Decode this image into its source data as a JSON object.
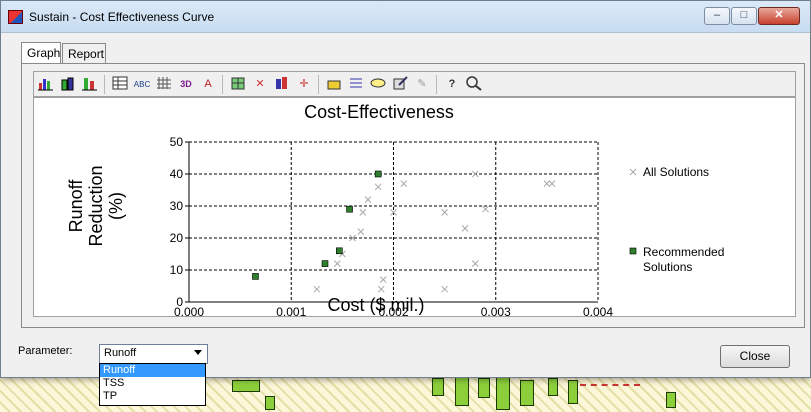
{
  "window": {
    "title": "Sustain - Cost Effectiveness Curve"
  },
  "title_buttons": {
    "minimize": "–",
    "maximize": "□",
    "close": "✕"
  },
  "tabs": [
    {
      "label": "Graph"
    },
    {
      "label": "Report"
    }
  ],
  "toolbar_icons": [
    "bar-chart-icon",
    "3d-bar-icon",
    "stacked-bar-icon",
    "table-icon",
    "abc-text-icon",
    "grid-lines-icon",
    "3d-view-icon",
    "font-style-icon",
    "pattern-icon",
    "scatter-icon",
    "color-scheme-icon",
    "axis-icon",
    "highlight-icon",
    "legend-list-icon",
    "label-icon",
    "edit-icon",
    "pen-icon",
    "help-icon",
    "zoom-icon"
  ],
  "chart_data": {
    "type": "scatter",
    "title": "Cost-Effectiveness",
    "xlabel": "Cost ($ mil.)",
    "ylabel_lines": [
      "Runoff",
      "Reduction",
      "(%)"
    ],
    "xlim": [
      0,
      0.004
    ],
    "ylim": [
      0,
      50
    ],
    "x_ticks": [
      "0.000",
      "0.001",
      "0.002",
      "0.003",
      "0.004"
    ],
    "y_ticks": [
      "0",
      "10",
      "20",
      "30",
      "40",
      "50"
    ],
    "grid": true,
    "legend_position": "right",
    "series": [
      {
        "name": "All Solutions",
        "marker": "x",
        "color": "#a8a8a8",
        "points": [
          [
            0.00125,
            4
          ],
          [
            0.00145,
            12
          ],
          [
            0.0015,
            15
          ],
          [
            0.0016,
            20
          ],
          [
            0.00168,
            22
          ],
          [
            0.0017,
            28
          ],
          [
            0.00175,
            32
          ],
          [
            0.00185,
            36
          ],
          [
            0.00188,
            4
          ],
          [
            0.0019,
            7
          ],
          [
            0.002,
            28
          ],
          [
            0.0021,
            37
          ],
          [
            0.0025,
            4
          ],
          [
            0.0025,
            28
          ],
          [
            0.0027,
            23
          ],
          [
            0.0028,
            12
          ],
          [
            0.0029,
            29
          ],
          [
            0.0028,
            40
          ],
          [
            0.0035,
            37
          ],
          [
            0.00355,
            37
          ]
        ]
      },
      {
        "name": "Recommended Solutions",
        "marker": "square",
        "color": "#2f7f2f",
        "points": [
          [
            0.00065,
            8
          ],
          [
            0.00133,
            12
          ],
          [
            0.00147,
            16
          ],
          [
            0.00157,
            29
          ],
          [
            0.00185,
            40
          ]
        ]
      }
    ]
  },
  "legend": {
    "all": "All Solutions",
    "rec_line1": "Recommended",
    "rec_line2": "Solutions"
  },
  "parameter": {
    "label": "Parameter:",
    "selected": "Runoff",
    "options": [
      "Runoff",
      "TSS",
      "TP"
    ]
  },
  "close_button": {
    "label": "Close"
  }
}
